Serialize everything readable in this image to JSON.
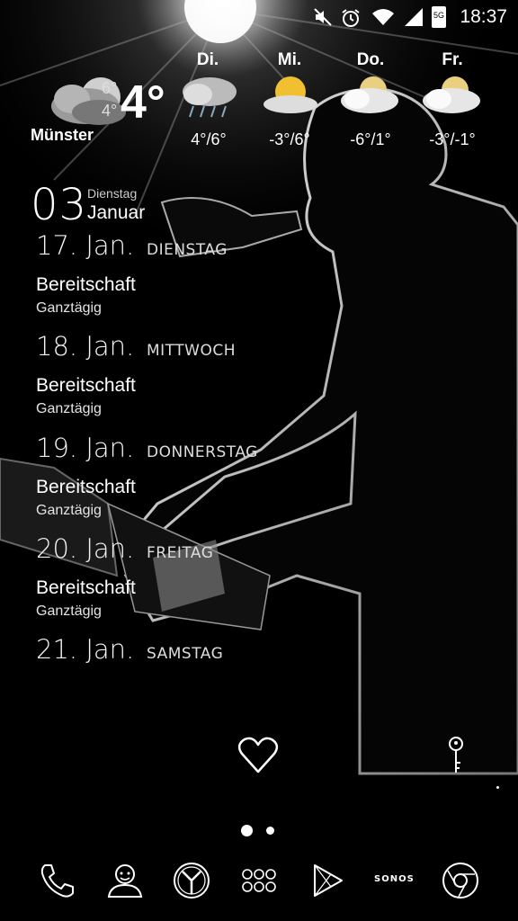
{
  "status_bar": {
    "time": "18:37",
    "network": "5G",
    "icons": [
      "mute-icon",
      "alarm-icon",
      "wifi-icon",
      "signal-icon",
      "battery-icon"
    ]
  },
  "weather": {
    "city": "Münster",
    "current_temp": "4°",
    "high": "6°",
    "low": "4°",
    "forecast": [
      {
        "day": "Di.",
        "temps": "4°/6°",
        "icon": "rain-cloud-icon"
      },
      {
        "day": "Mi.",
        "temps": "-3°/6°",
        "icon": "sun-cloud-icon"
      },
      {
        "day": "Do.",
        "temps": "-6°/1°",
        "icon": "cloud-sun-icon"
      },
      {
        "day": "Fr.",
        "temps": "-3°/-1°",
        "icon": "cloud-sun-icon"
      }
    ]
  },
  "date_header": {
    "day": "03",
    "weekday": "Dienstag",
    "month": "Januar"
  },
  "agenda": [
    {
      "date": "17. Jan.",
      "weekday": "DIENSTAG",
      "event": "Bereitschaft",
      "detail": "Ganztägig"
    },
    {
      "date": "18. Jan.",
      "weekday": "MITTWOCH",
      "event": "Bereitschaft",
      "detail": "Ganztägig"
    },
    {
      "date": "19. Jan.",
      "weekday": "DONNERSTAG",
      "event": "Bereitschaft",
      "detail": "Ganztägig"
    },
    {
      "date": "20. Jan.",
      "weekday": "FREITAG",
      "event": "Bereitschaft",
      "detail": "Ganztägig"
    },
    {
      "date": "21. Jan.",
      "weekday": "SAMSTAG",
      "event": "",
      "detail": ""
    }
  ],
  "dock": {
    "sonos_label": "SONOS",
    "icons": [
      "phone-icon",
      "contacts-icon",
      "clock-app-icon",
      "app-drawer-icon",
      "play-store-icon",
      "sonos-icon",
      "chrome-icon"
    ]
  },
  "page_indicator": {
    "pages": 2,
    "current": 1
  }
}
